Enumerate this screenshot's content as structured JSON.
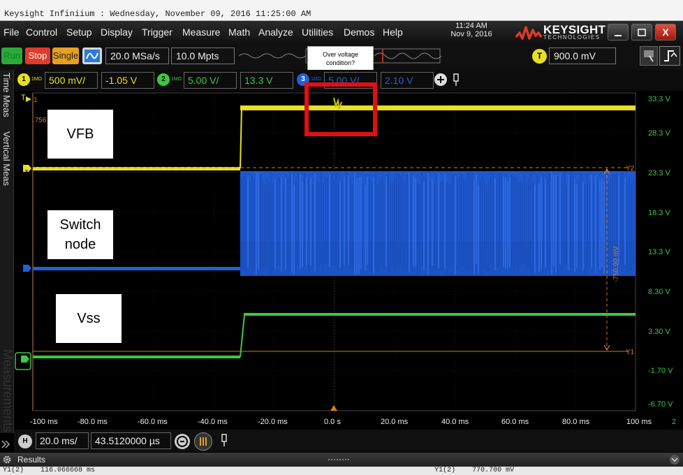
{
  "window": {
    "title": "Keysight Infiniium : Wednesday, November 09, 2016 11:25:00 AM"
  },
  "menu": [
    "File",
    "Control",
    "Setup",
    "Display",
    "Trigger",
    "Measure",
    "Math",
    "Analyze",
    "Utilities",
    "Demos",
    "Help"
  ],
  "clock": {
    "time": "11:24 AM",
    "date": "Nov 9, 2016"
  },
  "brand": {
    "name": "KEYSIGHT",
    "sub": "TECHNOLOGIES"
  },
  "window_buttons": {
    "close": "X"
  },
  "toolbar": {
    "run": "Run",
    "stop": "Stop",
    "single": "Single",
    "sample_rate": "20.0 MSa/s",
    "memory_depth": "10.0 Mpts",
    "trigger_level": "900.0 mV",
    "trigger_badge": "T"
  },
  "annotation_callout": "Over voltage condition?",
  "channels": [
    {
      "number": "1",
      "impedance": "1MΩ",
      "scale": "500 mV/",
      "offset": "-1.05 V",
      "color": "#e8e020"
    },
    {
      "number": "2",
      "impedance": "1MΩ",
      "scale": "5.00 V/",
      "offset": "13.3 V",
      "color": "#3ec83e"
    },
    {
      "number": "3",
      "impedance": "1MΩ",
      "scale": "5.00 V/",
      "offset": "2.10 V",
      "color": "#2060d8"
    }
  ],
  "side_tabs": [
    "Time Meas",
    "Vertical Meas"
  ],
  "side_watermark": "Measurements",
  "right_axis_labels": [
    "33.3 V",
    "28.3 V",
    "23.3 V",
    "18.3 V",
    "13.3 V",
    "8.30 V",
    "3.30 V",
    "-1.70 V",
    "-6.70 V"
  ],
  "time_axis_labels": [
    "-100 ms",
    "-80.0 ms",
    "-60.0 ms",
    "-40.0 ms",
    "-20.0 ms",
    "0.0 s",
    "20.0 ms",
    "40.0 ms",
    "60.0 ms",
    "80.0 ms",
    "100 ms"
  ],
  "time_axis_suffix": "2",
  "markers": {
    "trigger": "T",
    "ch1": "1",
    "ref_value": ".756",
    "y2": "Y2",
    "y1": "Y1",
    "delta": "-750.90 mV"
  },
  "signal_labels": {
    "vfb": "VFB",
    "switch_node": "Switch node",
    "vss": "Vss"
  },
  "horizontal": {
    "badge": "H",
    "scale": "20.0 ms/",
    "position": "43.5120000 µs"
  },
  "results": {
    "title": "Results",
    "row": "Y1(2)    116.066668 ms                                                                                 Y1(2)    770.700 mV"
  },
  "colors": {
    "ch1": "#e8e020",
    "ch2": "#3ec83e",
    "ch3": "#2060d8",
    "cursor": "#e07818",
    "highlight": "#e01010"
  }
}
